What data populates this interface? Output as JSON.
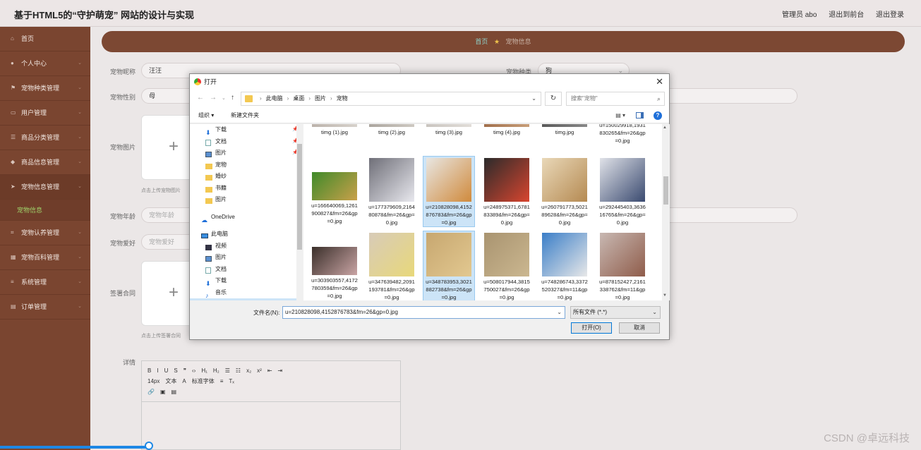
{
  "header": {
    "title": "基于HTML5的“守护萌宠” 网站的设计与实现",
    "admin": "管理员 abo",
    "to_front": "退出到前台",
    "logout": "退出登录"
  },
  "sidebar": {
    "items": [
      {
        "label": "首页",
        "icon": "home-icon"
      },
      {
        "label": "个人中心",
        "icon": "user-icon"
      },
      {
        "label": "宠物种类管理",
        "icon": "flag-icon"
      },
      {
        "label": "用户管理",
        "icon": "monitor-icon"
      },
      {
        "label": "商品分类管理",
        "icon": "list-icon"
      },
      {
        "label": "商品信息管理",
        "icon": "tag-icon"
      },
      {
        "label": "宠物信息管理",
        "icon": "send-icon"
      },
      {
        "label": "宠物认养管理",
        "icon": "crop-icon"
      },
      {
        "label": "宠物百科管理",
        "icon": "grid-icon"
      },
      {
        "label": "系统管理",
        "icon": "menu-icon"
      },
      {
        "label": "订单管理",
        "icon": "doc-icon"
      }
    ],
    "sub_active": "宠物信息"
  },
  "breadcrumb": {
    "home": "首页",
    "current": "宠物信息"
  },
  "form": {
    "name_label": "宠物昵称",
    "name_value": "汪汪",
    "type_label": "宠物种类",
    "type_value": "狗",
    "gender_label": "宠物性别",
    "gender_value": "母",
    "image_label": "宠物图片",
    "image_hint": "点击上传宠物图片",
    "age_label": "宠物年龄",
    "age_placeholder": "宠物年龄",
    "hobby_label": "宠物爱好",
    "hobby_placeholder": "宠物爱好",
    "contract_label": "签署合同",
    "contract_hint": "点击上传签署合同",
    "detail_label": "详情",
    "editor": {
      "row1": [
        "B",
        "I",
        "U",
        "S",
        "❞",
        "‹›",
        "H₁",
        "H₂",
        "☰",
        "☷",
        "x₂",
        "x²",
        "⇤",
        "⇥"
      ],
      "row2": [
        "14px",
        "文本",
        "A",
        "标准字体",
        "≡",
        "Tₓ"
      ],
      "row3": [
        "🔗",
        "▣",
        "▤"
      ]
    }
  },
  "dialog": {
    "title": "打开",
    "close": "✕",
    "path": [
      "此电脑",
      "桌面",
      "图片",
      "宠物"
    ],
    "search_placeholder": "搜索\"宠物\"",
    "organize": "组织 ▾",
    "new_folder": "新建文件夹",
    "tree": [
      {
        "label": "下载",
        "icon": "download-icon",
        "pinned": true
      },
      {
        "label": "文档",
        "icon": "document-icon",
        "pinned": true
      },
      {
        "label": "图片",
        "icon": "picture-icon",
        "pinned": true
      },
      {
        "label": "宠物",
        "icon": "folder-icon"
      },
      {
        "label": "婚纱",
        "icon": "folder-icon"
      },
      {
        "label": "书籍",
        "icon": "folder-icon"
      },
      {
        "label": "图片",
        "icon": "folder-icon"
      },
      {
        "label": "OneDrive",
        "icon": "cloud-icon"
      },
      {
        "label": "此电脑",
        "icon": "computer-icon"
      },
      {
        "label": "视频",
        "icon": "video-icon"
      },
      {
        "label": "图片",
        "icon": "picture-icon"
      },
      {
        "label": "文档",
        "icon": "document-icon"
      },
      {
        "label": "下载",
        "icon": "download-icon"
      },
      {
        "label": "音乐",
        "icon": "music-icon"
      },
      {
        "label": "桌面",
        "icon": "desktop-icon"
      }
    ],
    "files": [
      {
        "name": "timg (1).jpg",
        "colors": [
          "#b9b0a8",
          "#d8d3cd"
        ]
      },
      {
        "name": "timg (2).jpg",
        "colors": [
          "#a8a29b",
          "#cfcac3"
        ]
      },
      {
        "name": "timg (3).jpg",
        "colors": [
          "#c7c2bd",
          "#e2ded9"
        ]
      },
      {
        "name": "timg (4).jpg",
        "colors": [
          "#9d6a47",
          "#c9a07a"
        ]
      },
      {
        "name": "timg.jpg",
        "colors": [
          "#555555",
          "#8a8a8a"
        ]
      },
      {
        "name": "u=150029918,1931830265&fm=26&gp=0.jpg",
        "colors": []
      },
      {
        "name": "u=166640069,1261900827&fm=26&gp=0.jpg",
        "colors": [
          "#3f8a2a",
          "#c9a04a"
        ]
      },
      {
        "name": "u=177379609,216480878&fm=26&gp=0.jpg",
        "colors": [
          "#6f6f78",
          "#e8e8ee"
        ]
      },
      {
        "name": "u=210828098,4152876783&fm=26&gp=0.jpg",
        "colors": [
          "#e8e6e2",
          "#d08a3c"
        ]
      },
      {
        "name": "u=248975371,678183389&fm=26&gp=0.jpg",
        "colors": [
          "#2b2b2b",
          "#d8452f"
        ]
      },
      {
        "name": "u=260791773,502189628&fm=26&gp=0.jpg",
        "colors": [
          "#e9d8b8",
          "#b58a52"
        ]
      },
      {
        "name": "u=292445403,363616765&fm=26&gp=0.jpg",
        "colors": [
          "#e0e2e8",
          "#3a4a70"
        ]
      },
      {
        "name": "u=303903557,4172780359&fm=26&gp=0.jpg",
        "colors": [
          "#3a2f2a",
          "#c9a4a4"
        ]
      },
      {
        "name": "u=347639482,2091193781&fm=26&gp=0.jpg",
        "colors": [
          "#d8cbb8",
          "#e8d87a"
        ]
      },
      {
        "name": "u=348783953,3021882738&fm=26&gp=0.jpg",
        "colors": [
          "#c7a770",
          "#e2c890"
        ]
      },
      {
        "name": "u=508017944,3815750027&fm=26&gp=0.jpg",
        "colors": [
          "#a99470",
          "#cbb790"
        ]
      },
      {
        "name": "u=748286743,3372520327&fm=11&gp=0.jpg",
        "colors": [
          "#3a7ec8",
          "#e8e8e8"
        ]
      },
      {
        "name": "u=878152427,2161338762&fm=11&gp=0.jpg",
        "colors": [
          "#c8b8b2",
          "#8f5c4a"
        ]
      }
    ],
    "selected_files": [
      8,
      14
    ],
    "filename_label": "文件名(N):",
    "filename_value": "u=210828098,4152876783&fm=26&gp=0.jpg",
    "filetype_value": "所有文件 (*.*)",
    "open_label": "打开(O)",
    "cancel_label": "取消"
  },
  "watermark": "CSDN @卓远科技",
  "progress_fraction": 0.16
}
